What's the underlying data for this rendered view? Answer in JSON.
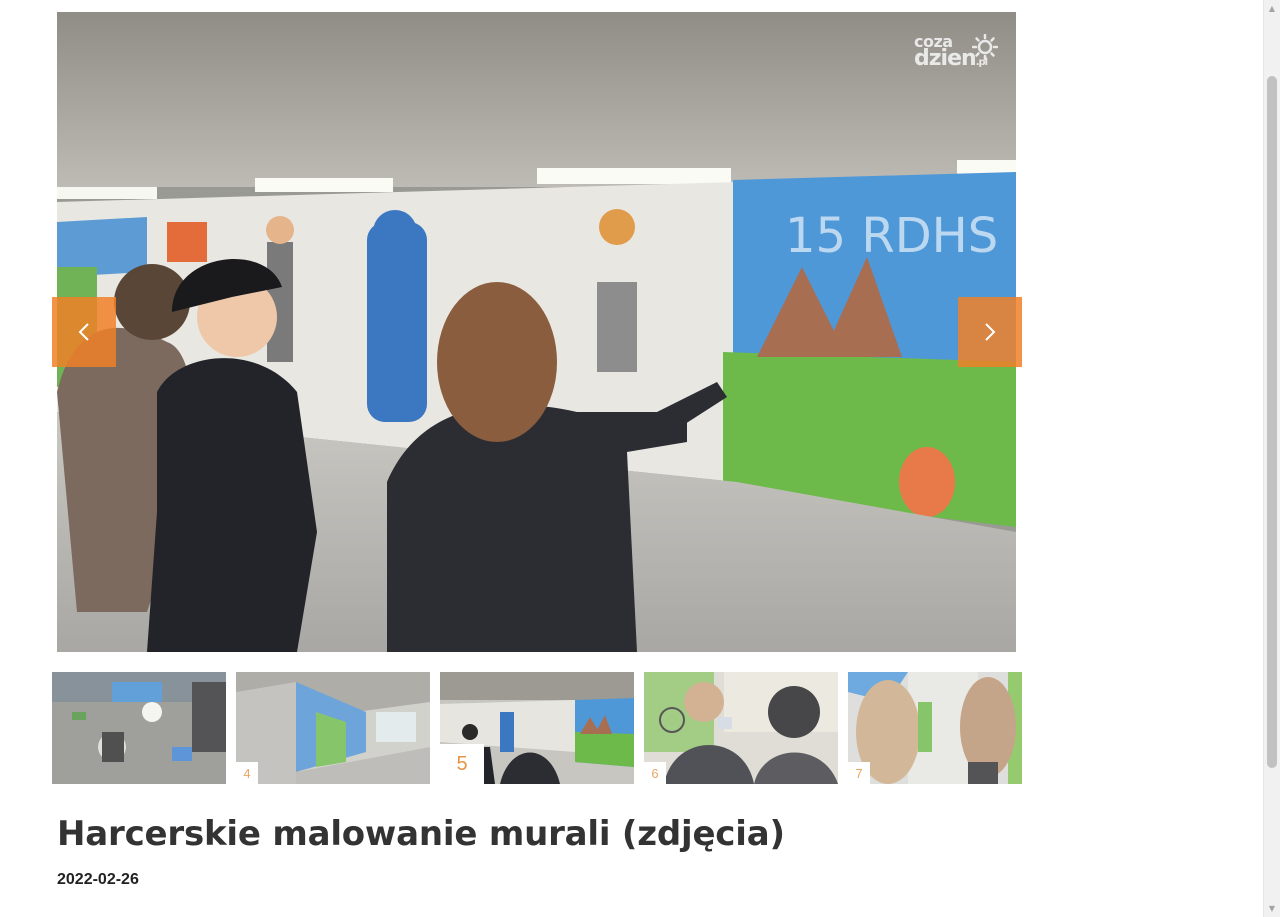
{
  "gallery": {
    "main_image_alt": "Harcerki malujące mural w przejściu podziemnym",
    "watermark": {
      "top": "coza",
      "bottom": "dzien",
      "suffix": ".pl"
    },
    "prev_icon": "chevron-left-icon",
    "next_icon": "chevron-right-icon",
    "accent_color": "#f08028",
    "thumbnails": [
      {
        "number": "",
        "alt": "Puszki z farbą na podłodze"
      },
      {
        "number": "4",
        "alt": "Przejście podziemne"
      },
      {
        "number": "5",
        "alt": "Malowanie muralu 15 RDHS",
        "active": true
      },
      {
        "number": "6",
        "alt": "Zdjęcie telefonem"
      },
      {
        "number": "7",
        "alt": "Harcerki przy ścianie"
      }
    ]
  },
  "article": {
    "title": "Harcerskie malowanie murali (zdjęcia)",
    "date": "2022-02-26"
  }
}
